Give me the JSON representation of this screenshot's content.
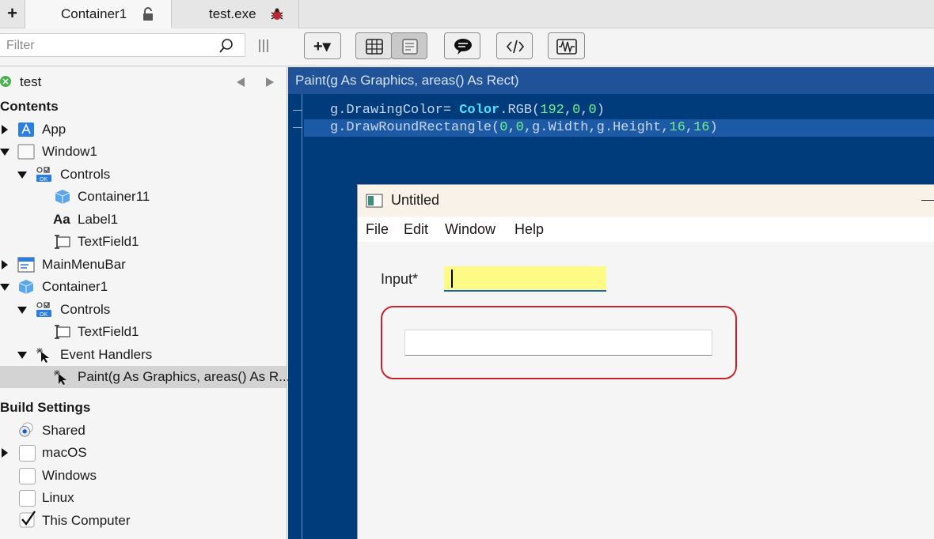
{
  "tabs": {
    "new_tab": "+",
    "items": [
      {
        "label": "Container1",
        "icon": "unlocked-lock-icon"
      },
      {
        "label": "test.exe",
        "icon": "bug-icon"
      }
    ]
  },
  "toolbar": {
    "filter_placeholder": "Filter",
    "add_button": "+▾",
    "buttons": [
      "add-button",
      "layout-view-button",
      "code-view-button",
      "comments-button",
      "code-editor-button",
      "profiler-button"
    ]
  },
  "navigator": {
    "project": "test",
    "contents_heading": "Contents",
    "items": [
      {
        "label": "App",
        "icon": "app-icon"
      },
      {
        "label": "Window1",
        "icon": "window-icon"
      },
      {
        "label": "Controls",
        "icon": "controls-icon"
      },
      {
        "label": "Container11",
        "icon": "cube-icon"
      },
      {
        "label": "Label1",
        "icon": "label-icon"
      },
      {
        "label": "TextField1",
        "icon": "textfield-icon"
      },
      {
        "label": "MainMenuBar",
        "icon": "menubar-icon"
      },
      {
        "label": "Container1",
        "icon": "cube-icon"
      },
      {
        "label": "Controls",
        "icon": "controls-icon"
      },
      {
        "label": "TextField1",
        "icon": "textfield-icon"
      },
      {
        "label": "Event Handlers",
        "icon": "event-icon"
      },
      {
        "label": "Paint(g As Graphics, areas() As R...",
        "icon": "event-icon"
      }
    ],
    "build_heading": "Build Settings",
    "build_items": [
      {
        "label": "Shared",
        "checked": true
      },
      {
        "label": "macOS",
        "checked": false
      },
      {
        "label": "Windows",
        "checked": false
      },
      {
        "label": "Linux",
        "checked": false
      },
      {
        "label": "This Computer",
        "checked": true
      }
    ]
  },
  "editor": {
    "method_signature": "Paint(g As Graphics, areas() As Rect)",
    "line1": {
      "obj": "g.DrawingColor= ",
      "cls": "Color",
      "rest": ".RGB(",
      "n1": "192",
      "s1": ",",
      "n2": "0",
      "s2": ",",
      "n3": "0",
      "end": ")"
    },
    "line2": {
      "obj": "g.DrawRoundRectangle(",
      "n1": "0",
      "s1": ",",
      "n2": "0",
      "mid": ",g.Width,g.Height,",
      "n3": "16",
      "s2": ",",
      "n4": "16",
      "end": ")"
    }
  },
  "runtime_window": {
    "title": "Untitled",
    "menus": [
      "File",
      "Edit",
      "Window",
      "Help"
    ],
    "input_label": "Input*",
    "input_value": "",
    "inner_value": ""
  },
  "colors": {
    "editor_bg": "#003b7c",
    "highlight": "#1d5aa6",
    "input_bg": "#fdfa86",
    "border_red": "#c8242c"
  }
}
